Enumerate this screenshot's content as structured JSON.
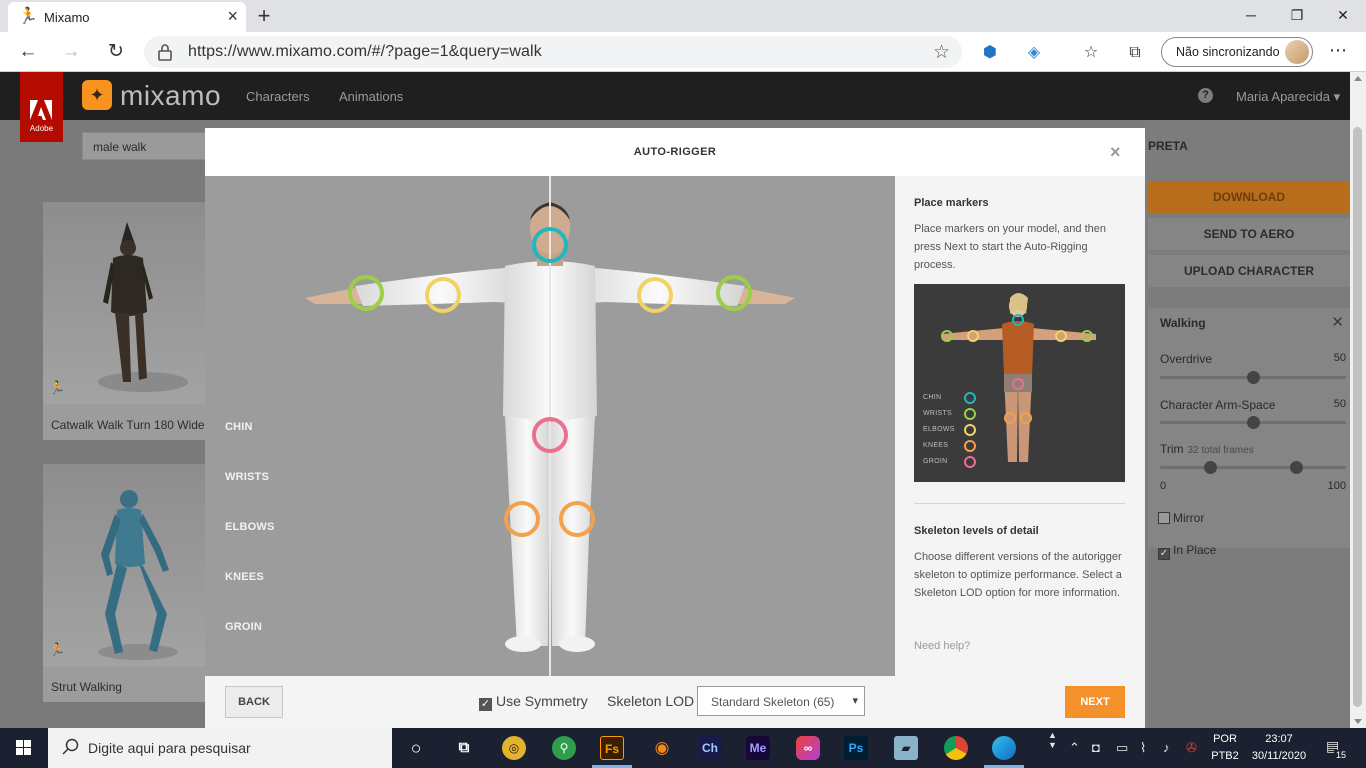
{
  "browser": {
    "tab_title": "Mixamo",
    "new_tab": "+",
    "url": "https://www.mixamo.com/#/?page=1&query=walk",
    "profile_label": "Não sincronizando",
    "window_controls": {
      "minimize": "─",
      "restore": "❐",
      "close": "✕"
    }
  },
  "mixamo": {
    "logo_text": "mixamo",
    "adobe_text": "Adobe",
    "nav": [
      "Characters",
      "Animations"
    ],
    "user": "Maria Aparecida",
    "search_value": "male walk",
    "cards": [
      {
        "label": "Catwalk Walk Turn 180 Wide"
      },
      {
        "label": "Strut Walking"
      }
    ],
    "right_panel": {
      "title": "PRETA",
      "download": "DOWNLOAD",
      "send_to_aero": "SEND TO AERO",
      "upload_character": "UPLOAD CHARACTER",
      "animation_title": "Walking",
      "sliders": [
        {
          "label": "Overdrive",
          "value": "50",
          "level": 0.5
        },
        {
          "label": "Character Arm-Space",
          "value": "50",
          "level": 0.5
        }
      ],
      "trim": {
        "label": "Trim",
        "hint": "32 total frames",
        "min": "0",
        "max": "100",
        "start_level": 0.27,
        "end_level": 0.73
      },
      "mirror": {
        "label": "Mirror",
        "checked": false
      },
      "in_place": {
        "label": "In Place",
        "checked": true
      }
    }
  },
  "modal": {
    "title": "AUTO-RIGGER",
    "close": "×",
    "marker_labels": [
      "CHIN",
      "WRISTS",
      "ELBOWS",
      "KNEES",
      "GROIN"
    ],
    "marker_colors": {
      "chin": "#23b6c1",
      "wrists": "#9ccf45",
      "elbows": "#f1d262",
      "knees": "#f3a14c",
      "groin": "#ec6f8f"
    },
    "side": {
      "place_title": "Place markers",
      "place_body": "Place markers on your model, and then press Next to start the Auto-Rigging process.",
      "preview_labels": [
        "CHIN",
        "WRISTS",
        "ELBOWS",
        "KNEES",
        "GROIN"
      ],
      "lod_title": "Skeleton levels of detail",
      "lod_body": "Choose different versions of the autorigger skeleton to optimize performance. Select a Skeleton LOD option for more information.",
      "help": "Need help?"
    },
    "footer": {
      "back": "BACK",
      "symmetry_label": "Use Symmetry",
      "symmetry_checked": true,
      "lod_label": "Skeleton LOD",
      "lod_value": "Standard Skeleton (65)",
      "next": "NEXT"
    }
  },
  "taskbar": {
    "search_placeholder": "Digite aqui para pesquisar",
    "apps": [
      "Ch",
      "Me",
      "Ps",
      "Fs"
    ],
    "lang_top": "POR",
    "lang_bottom": "PTB2",
    "time": "23:07",
    "date": "30/11/2020",
    "notifications": "15"
  }
}
